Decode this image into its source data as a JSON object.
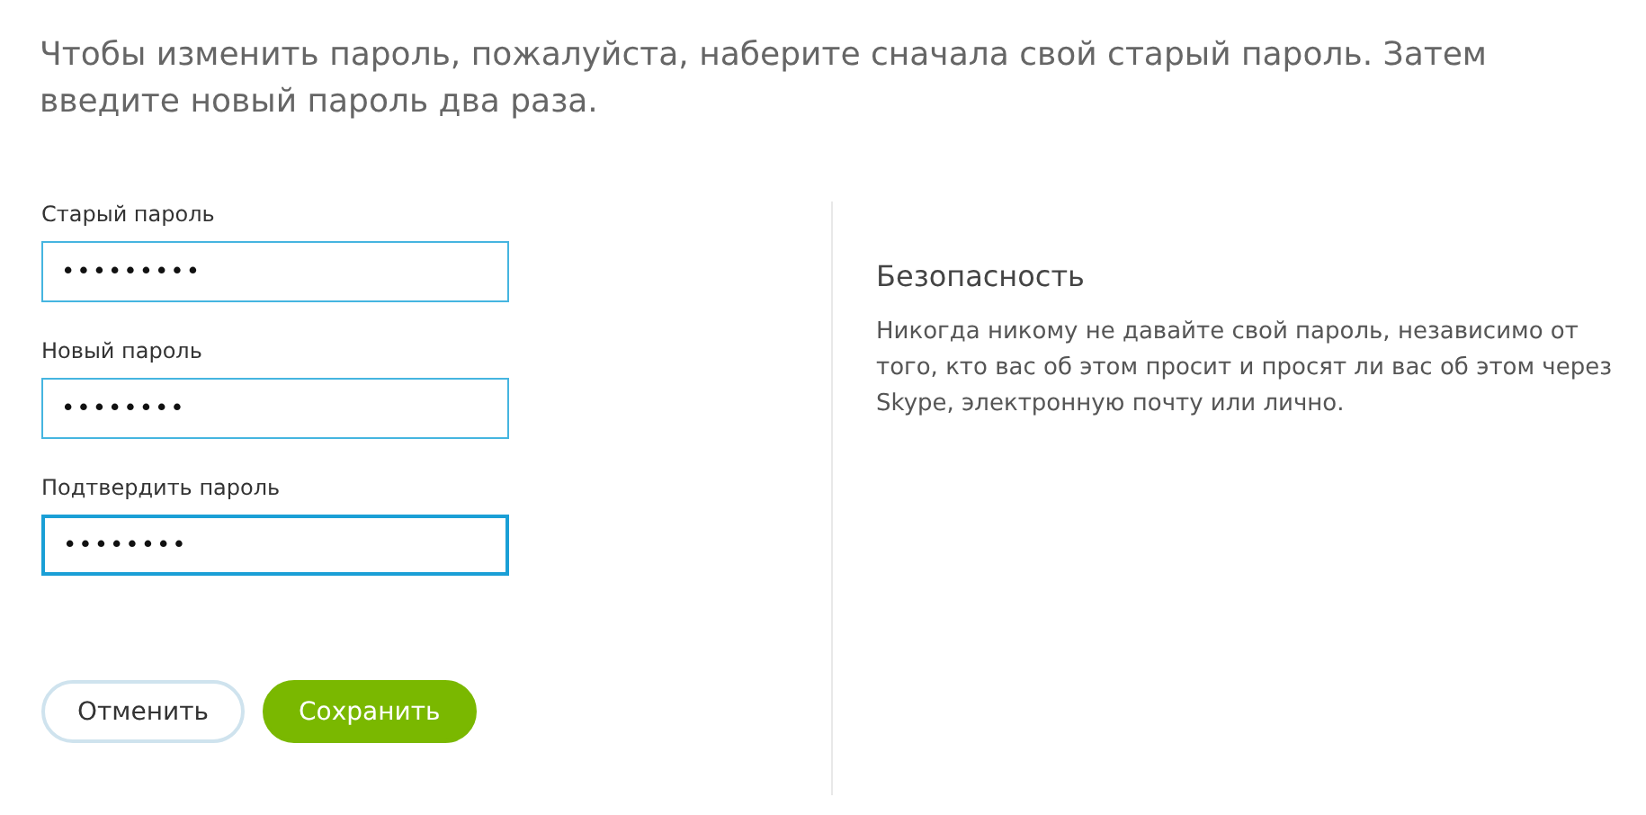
{
  "intro": "Чтобы изменить пароль, пожалуйста, наберите сначала свой старый пароль. Затем введите новый пароль два раза.",
  "fields": [
    {
      "label": "Старый пароль",
      "value": "•••••••••",
      "focused": false
    },
    {
      "label": "Новый пароль",
      "value": "••••••••",
      "focused": false
    },
    {
      "label": "Подтвердить пароль",
      "value": "••••••••",
      "focused": true
    }
  ],
  "buttons": [
    {
      "label": "Отменить",
      "kind": "secondary"
    },
    {
      "label": "Сохранить",
      "kind": "primary"
    }
  ],
  "security": {
    "title": "Безопасность",
    "text": "Никогда никому не давайте свой пароль, независимо от того, кто вас об этом просит и просят ли вас об этом через Skype, электронную почту или лично."
  }
}
